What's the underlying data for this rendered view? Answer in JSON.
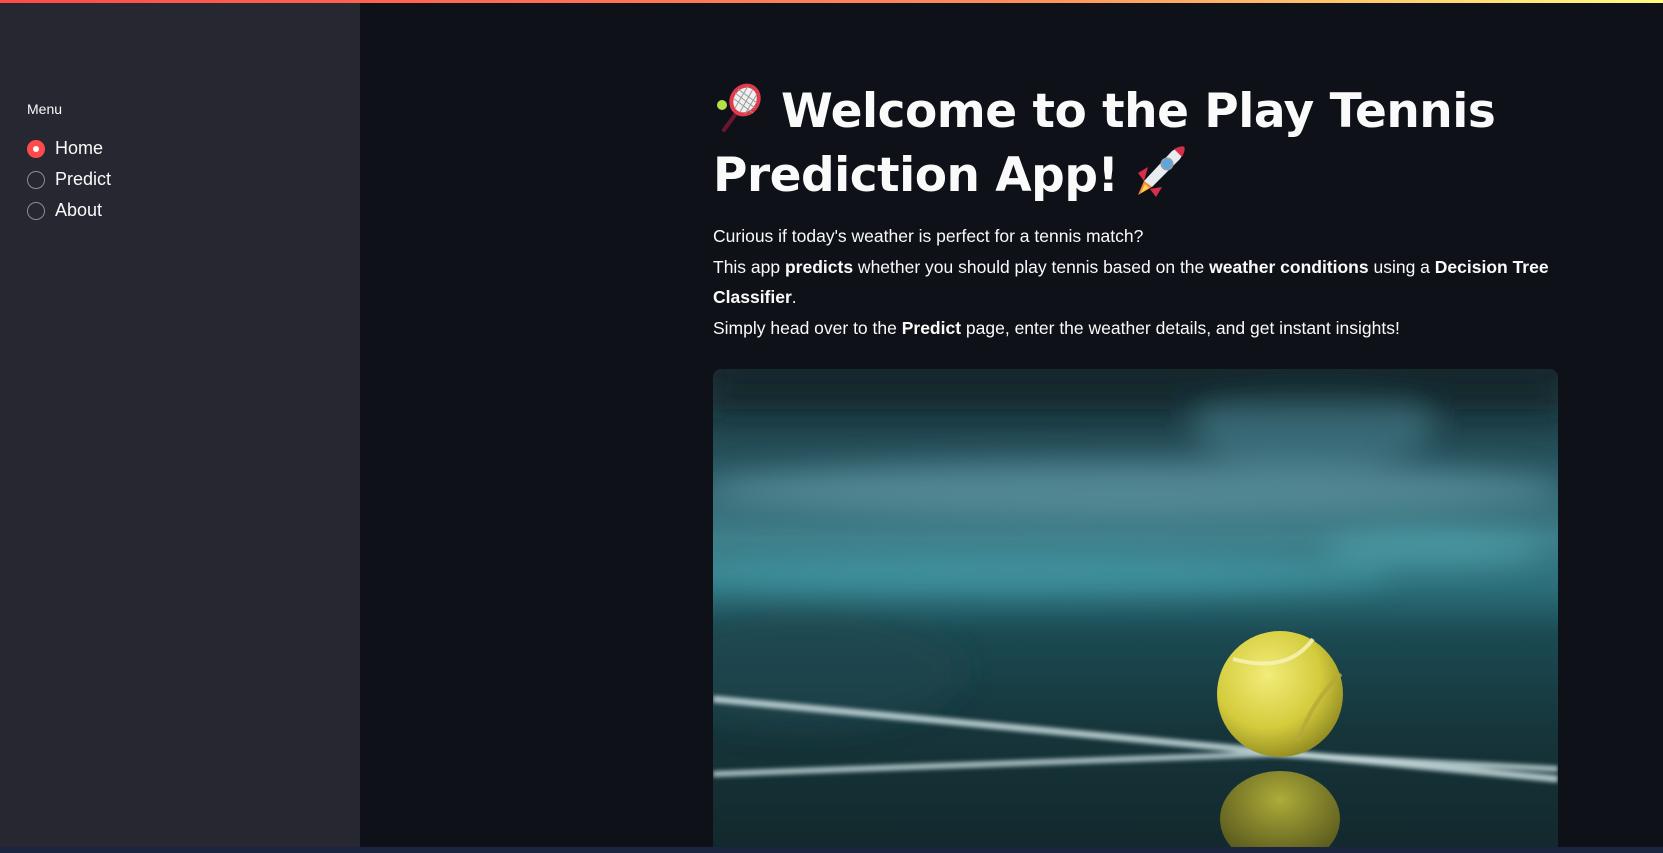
{
  "sidebar": {
    "menu_label": "Menu",
    "options": [
      {
        "label": "Home",
        "selected": true
      },
      {
        "label": "Predict",
        "selected": false
      },
      {
        "label": "About",
        "selected": false
      }
    ]
  },
  "main": {
    "title_line1": "Welcome to the Play Tennis",
    "title_line2": "Prediction App!",
    "title_icons": [
      "tennis-racket-icon",
      "rocket-icon"
    ],
    "intro": "Curious if today's weather is perfect for a tennis match?",
    "line2": {
      "t1": "This app ",
      "b1": "predicts",
      "t2": " whether you should play tennis based on the ",
      "b2": "weather conditions",
      "t3": " using a ",
      "b3": "Decision Tree Classifier",
      "t4": "."
    },
    "line3": {
      "t1": "Simply head over to the ",
      "b1": "Predict",
      "t2": " page, enter the weather details, and get instant insights!"
    },
    "hero_image": "tennis-ball-on-court-image"
  },
  "colors": {
    "accent": "#ff4b4b",
    "sidebar_bg": "#262730",
    "main_bg": "#0e1117",
    "text": "#fafafa"
  }
}
